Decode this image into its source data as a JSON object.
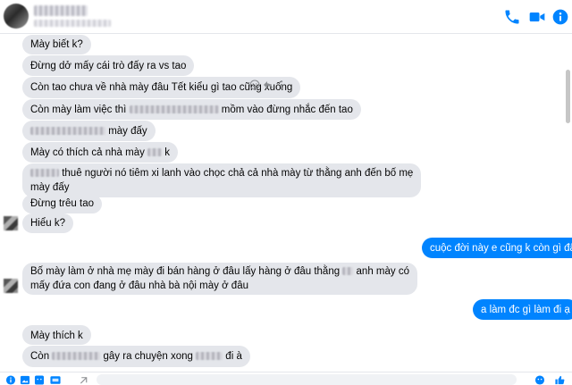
{
  "header": {
    "icons": [
      "phone-icon",
      "video-call-icon",
      "info-icon"
    ],
    "accent_color": "#0084ff"
  },
  "messages": {
    "m1": "Mày biết k?",
    "m2": "Đừng dở mấy cái trò đấy ra vs tao",
    "m3": "Còn tao chưa về nhà mày đâu Tết kiểu gì tao cũng xuống",
    "m4_pre": "Còn mày làm việc thì",
    "m4_post": "mồm vào đừng nhắc đến tao",
    "m5_post": "mày đấy",
    "m6_pre": "Mày có thích cả nhà mày",
    "m6_post": "k",
    "m7_l1_post": "thuê người nó tiêm xi lanh vào chọc chả cả nhà mày từ thằng anh đến bố mẹ",
    "m7_l2": "mày đấy",
    "m8": "Đừng trêu tao",
    "m9": "Hiểu k?",
    "m10_l1_pre": "Bố mày làm ở nhà mẹ mày đi bán hàng ở đâu lấy hàng ở đâu thằng",
    "m10_l1_post": "anh mày có",
    "m10_l2": "mấy đứa con đang ở đâu nhà bà nội mày ở đâu",
    "m11": "Mày thích k",
    "m12_pre": "Còn",
    "m12_mid": "gây ra chuyện xong",
    "m12_post": "đi à",
    "o1": "cuộc đời này e cũng k còn gì đâu",
    "o2": "a làm đc gì làm đi ạ"
  },
  "message_actions": [
    "emoji-reaction-icon",
    "reply-icon",
    "more-options-icon"
  ],
  "composer": {
    "icons": [
      "info-icon",
      "plus-icon",
      "image-icon",
      "sticker-icon",
      "gif-icon",
      "attach-icon",
      "emoji-icon",
      "like-icon"
    ]
  }
}
